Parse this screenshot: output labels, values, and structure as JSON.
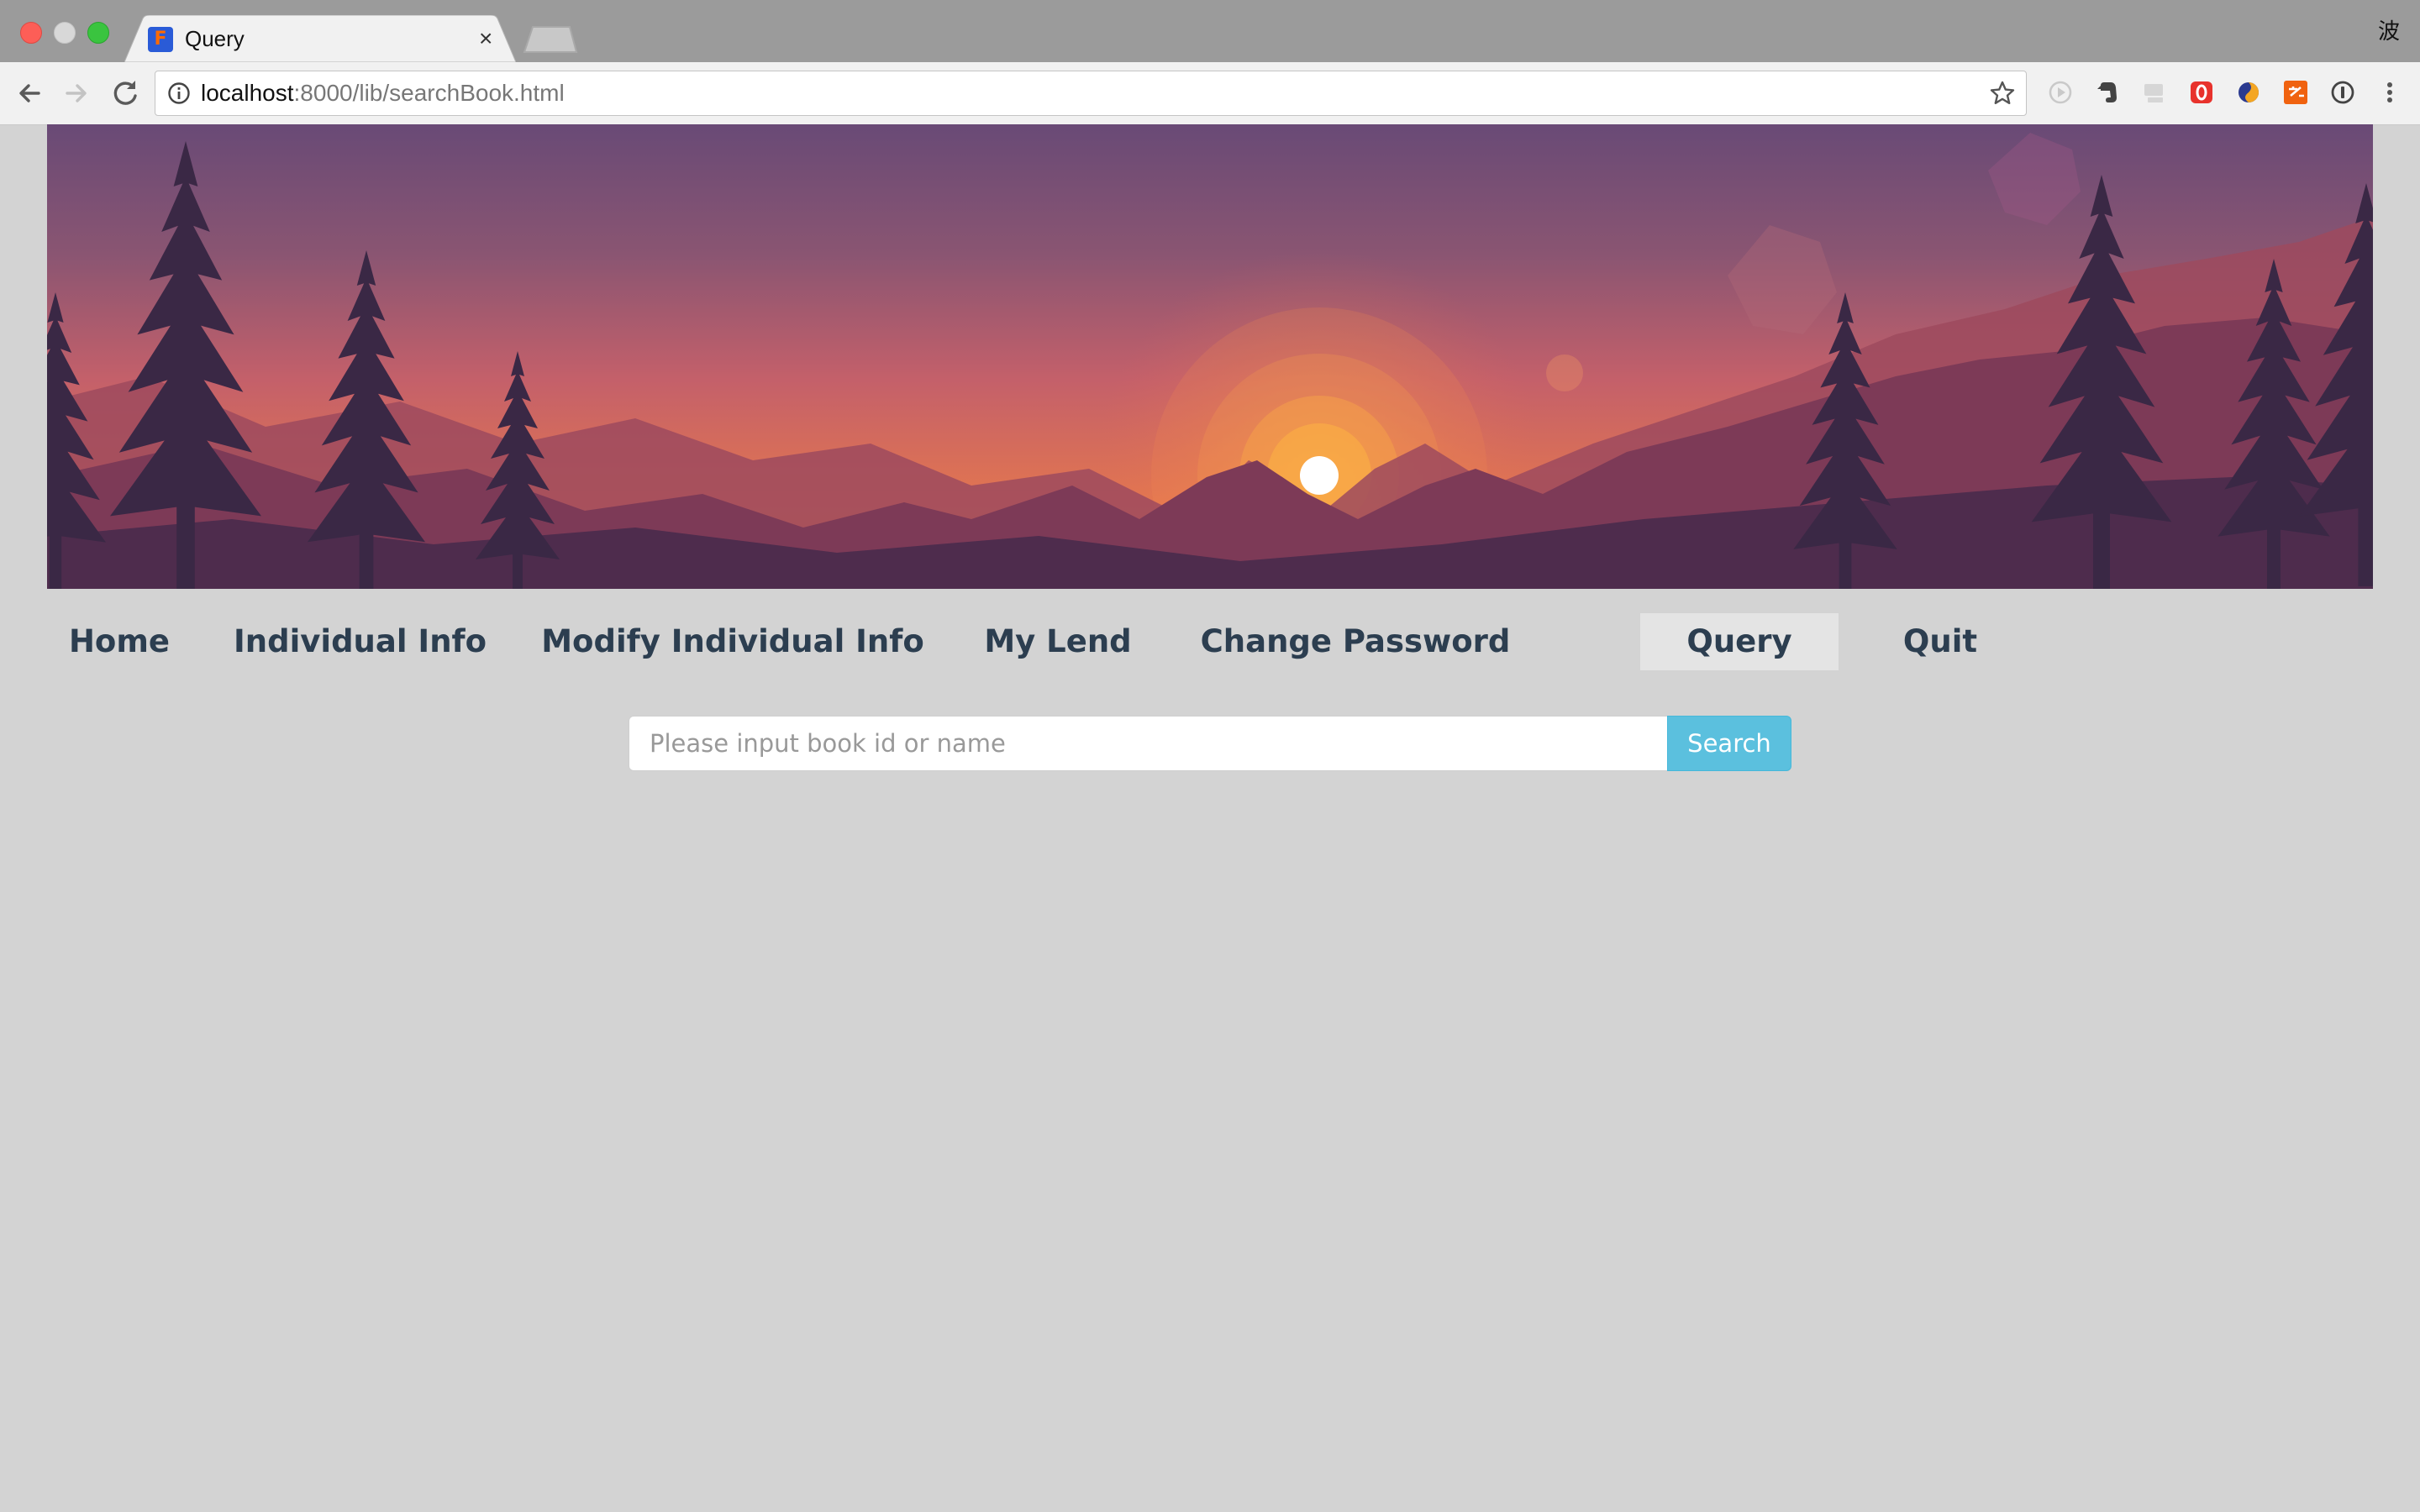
{
  "browser": {
    "tab_title": "Query",
    "tab_close": "×",
    "ime_indicator": "波",
    "url_host": "localhost",
    "url_path": ":8000/lib/searchBook.html",
    "extensions": [
      "play-icon",
      "evernote-icon",
      "flash-icon",
      "opera-icon",
      "sync-icon",
      "translate-icon",
      "onepassword-icon"
    ]
  },
  "nav": {
    "items": [
      {
        "label": "Home"
      },
      {
        "label": "Individual Info"
      },
      {
        "label": "Modify Individual Info"
      },
      {
        "label": "My Lend"
      },
      {
        "label": "Change Password"
      },
      {
        "label": "Query",
        "active": true
      },
      {
        "label": "Quit"
      }
    ]
  },
  "search": {
    "placeholder": "Please input book id or name",
    "value": "",
    "button_label": "Search"
  },
  "colors": {
    "page_bg": "#d3d3d3",
    "nav_text": "#2c3e50",
    "active_nav_bg": "#e4e4e4",
    "search_button": "#5bc0de"
  }
}
